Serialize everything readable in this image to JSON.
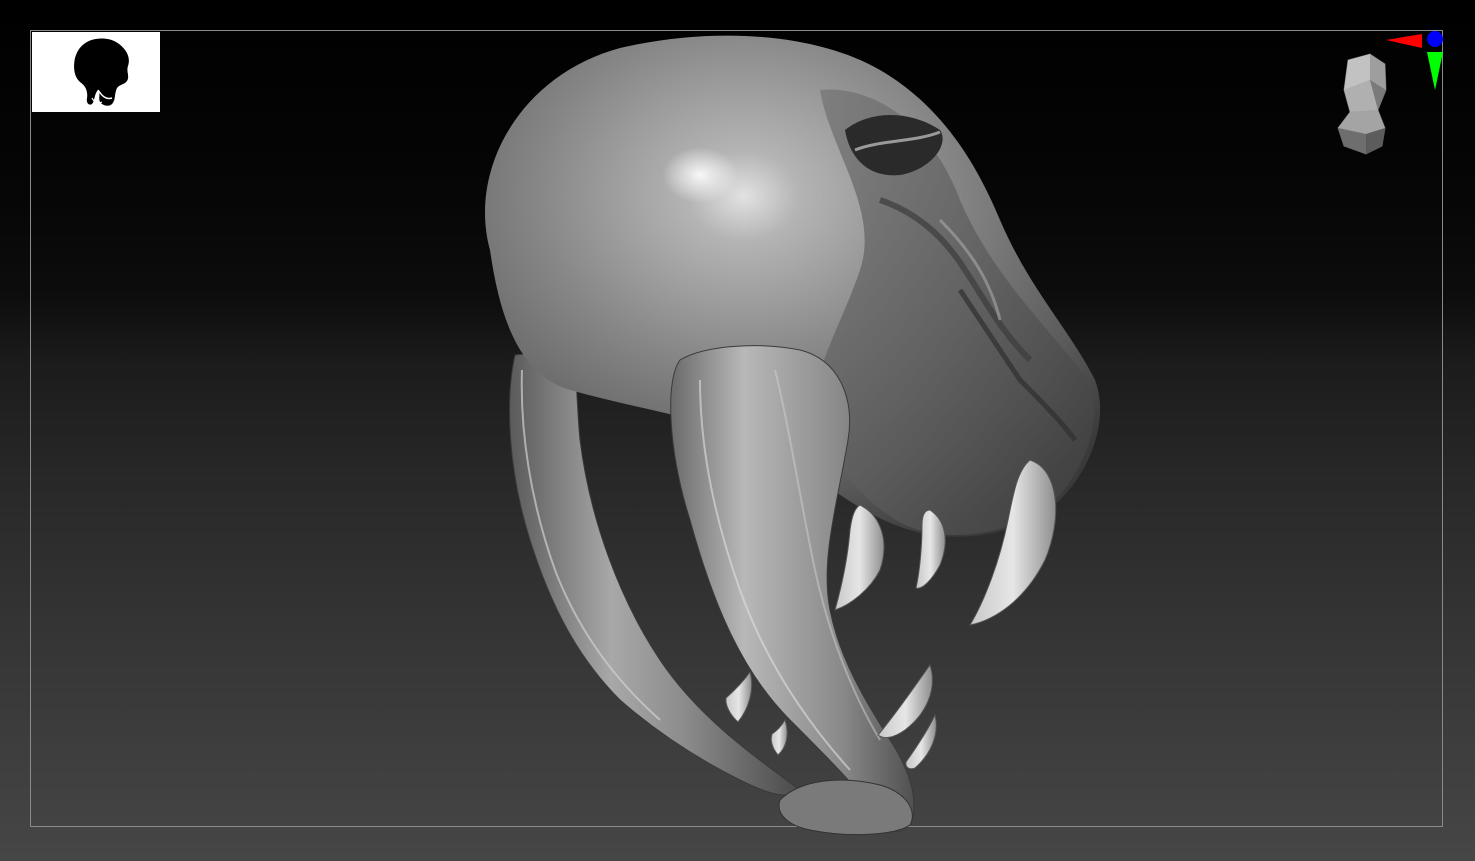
{
  "viewport": {
    "background_top": "#000000",
    "background_bottom": "#464646",
    "frame_color": "#8a8a8a"
  },
  "thumbnail": {
    "icon": "creature-skull-silhouette-icon",
    "background": "#ffffff",
    "fill": "#000000"
  },
  "model": {
    "icon": "creature-skull-sculpt",
    "material_color": "#9a9a9a"
  },
  "navigation": {
    "head_cube_icon": "head-orientation-icon",
    "axis_x_color": "#ff0000",
    "axis_y_color": "#00ff00",
    "axis_z_color": "#0000ff"
  }
}
